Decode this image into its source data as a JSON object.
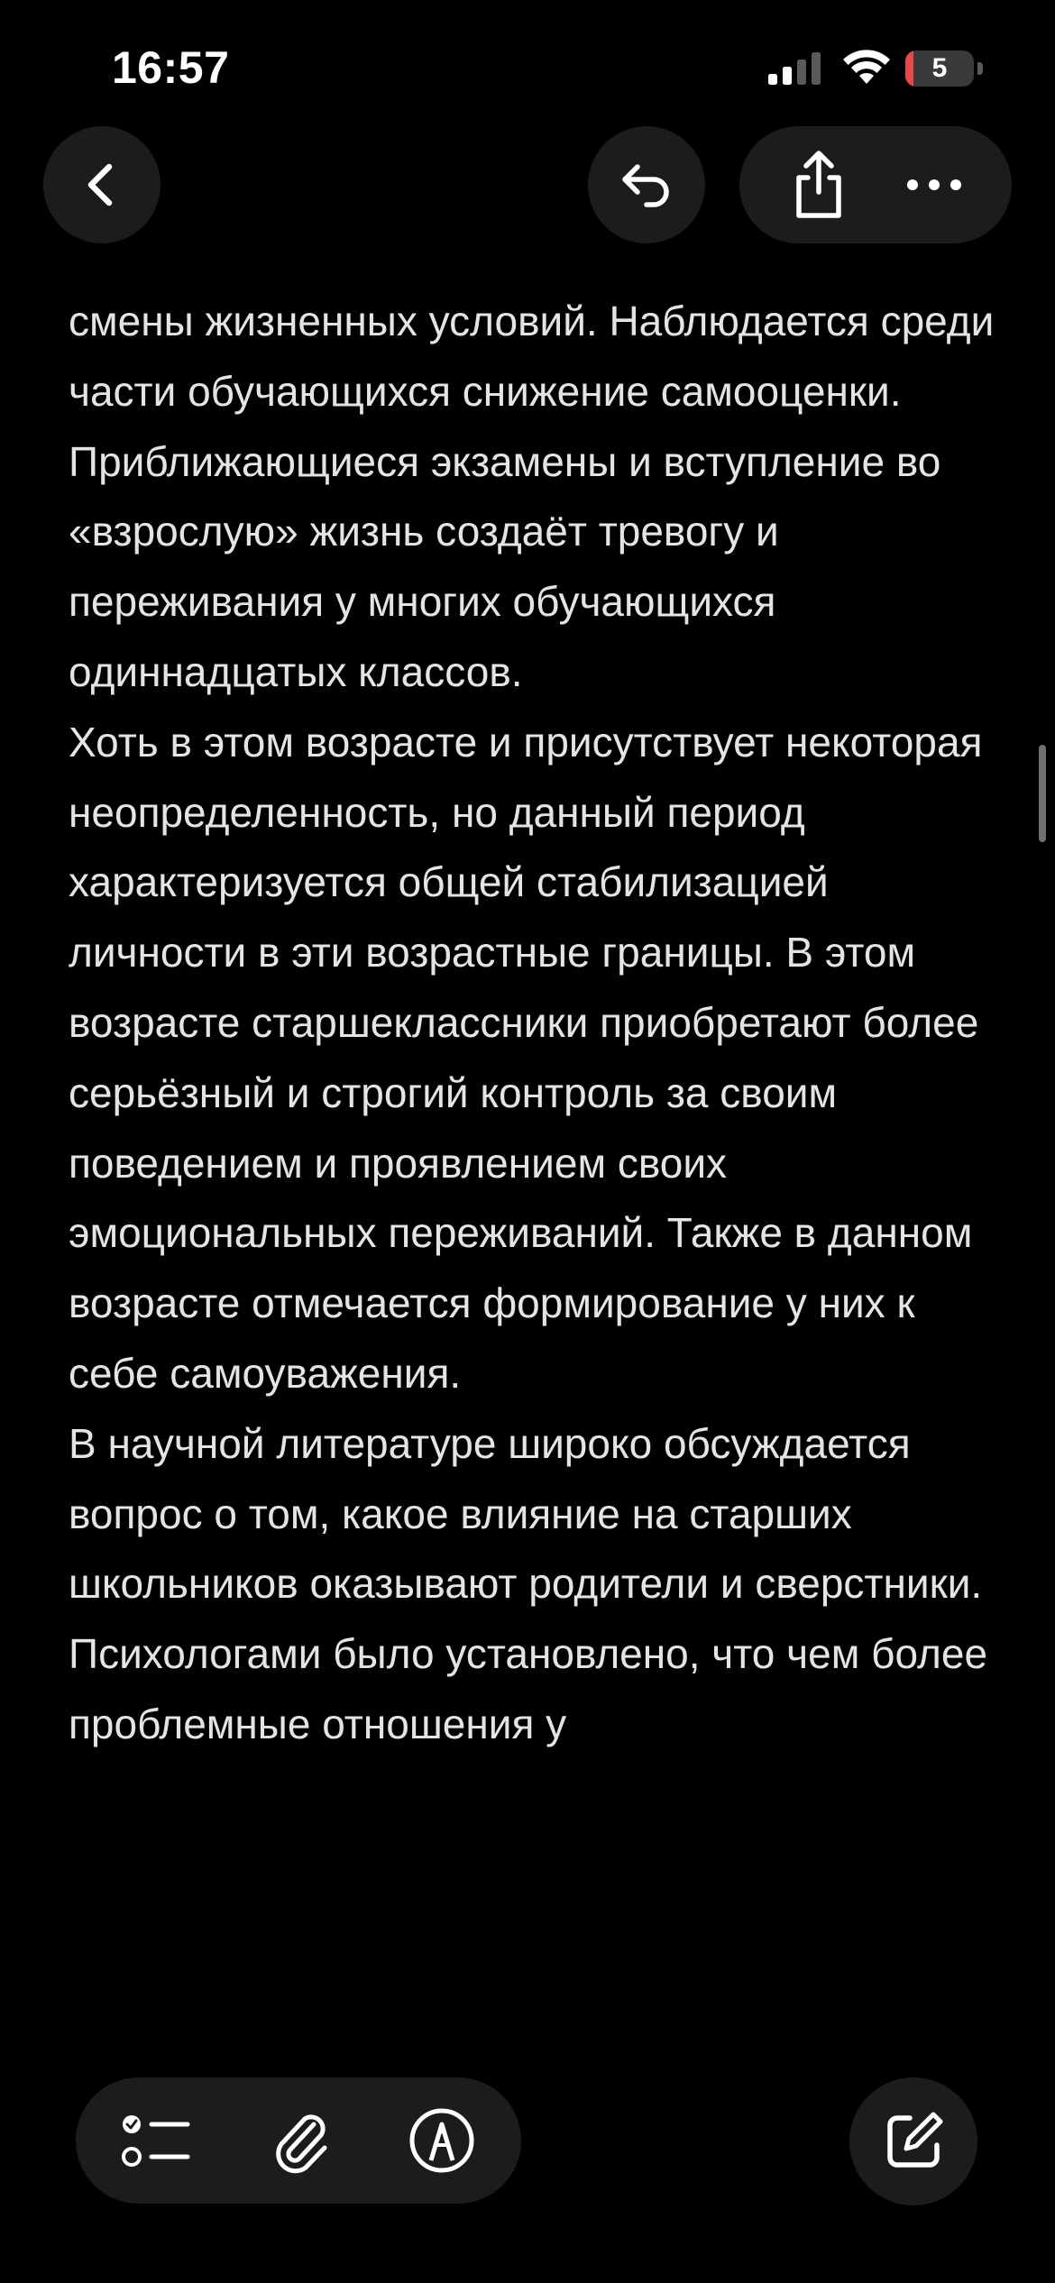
{
  "status_bar": {
    "time": "16:57",
    "battery_level": "5",
    "battery_fraction": 0.05
  },
  "navigation": {
    "back_icon": "chevron-left-icon",
    "undo_icon": "undo-arrow-icon",
    "share_icon": "share-icon",
    "more_icon": "ellipsis-icon"
  },
  "note": {
    "paragraphs": [
      "смены жизненных условий. Наблюдается среди части обучающихся снижение самооценки. Приближающиеся экзамены и вступление во «взрослую» жизнь создаёт тревогу и переживания у многих обучающихся одиннадцатых классов.",
      "Хоть в этом возрасте и присутствует некоторая неопределенность, но данный период характеризуется общей стабилизацией личности в эти возрастные границы. В этом возрасте старшеклассники приобретают более серьёзный и строгий контроль за своим поведением и проявлением своих эмоциональных переживаний. Также в данном возрасте отмечается формирование у них к себе самоуважения.",
      "В научной литературе широко обсуждается вопрос о том, какое влияние на старших школьников оказывают родители и сверстники. Психологами было установлено, что чем более проблемные отношения у"
    ]
  },
  "toolbar": {
    "checklist_icon": "checklist-icon",
    "attachment_icon": "paperclip-icon",
    "markup_icon": "markup-pen-icon",
    "compose_icon": "compose-icon"
  },
  "colors": {
    "background": "#000000",
    "button_bg": "#1c1c1e",
    "text": "#e4e4e4",
    "battery_low": "#e5484d"
  }
}
